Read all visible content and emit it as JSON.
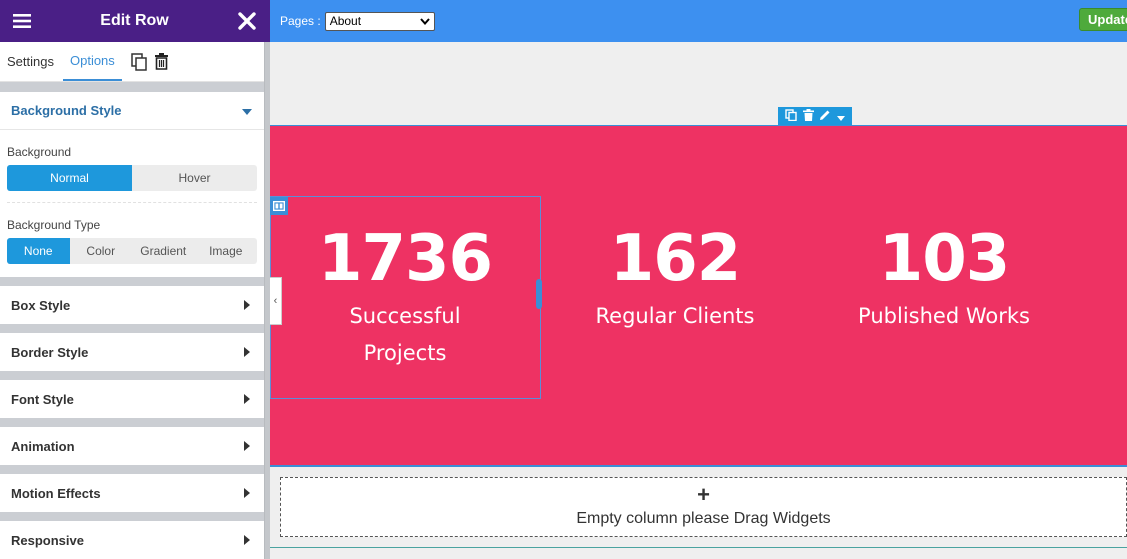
{
  "sidebar": {
    "title": "Edit Row",
    "tabs": [
      {
        "label": "Settings"
      },
      {
        "label": "Options"
      }
    ],
    "background_style": {
      "title": "Background Style",
      "background_label": "Background",
      "background_options": [
        "Normal",
        "Hover"
      ],
      "background_selected": "Normal",
      "type_label": "Background Type",
      "type_options": [
        "None",
        "Color",
        "Gradient",
        "Image"
      ],
      "type_selected": "None"
    },
    "sections": [
      {
        "label": "Box Style"
      },
      {
        "label": "Border Style"
      },
      {
        "label": "Font Style"
      },
      {
        "label": "Animation"
      },
      {
        "label": "Motion Effects"
      },
      {
        "label": "Responsive"
      }
    ]
  },
  "topbar": {
    "pages_label": "Pages :",
    "pages_selected": "About",
    "update_label": "Update"
  },
  "stats": [
    {
      "number": "1736",
      "label_line1": "Successful",
      "label_line2": "Projects"
    },
    {
      "number": "162",
      "label_line1": "Regular Clients",
      "label_line2": ""
    },
    {
      "number": "103",
      "label_line1": "Published Works",
      "label_line2": ""
    }
  ],
  "empty_column": {
    "plus": "+",
    "text": "Empty column please Drag Widgets"
  },
  "collapse_tab": "‹",
  "colors": {
    "sidebar_header": "#4a1f86",
    "topbar": "#3d90f0",
    "accent": "#1e98dc",
    "stats_bg": "#ee3263",
    "update_button": "#4eaa3c"
  },
  "icons": {
    "menu": "hamburger-menu-icon",
    "close": "close-icon",
    "duplicate": "duplicate-icon",
    "delete": "trash-icon",
    "edit": "pencil-icon",
    "dropdown": "caret-down-icon",
    "column": "column-layout-icon"
  }
}
